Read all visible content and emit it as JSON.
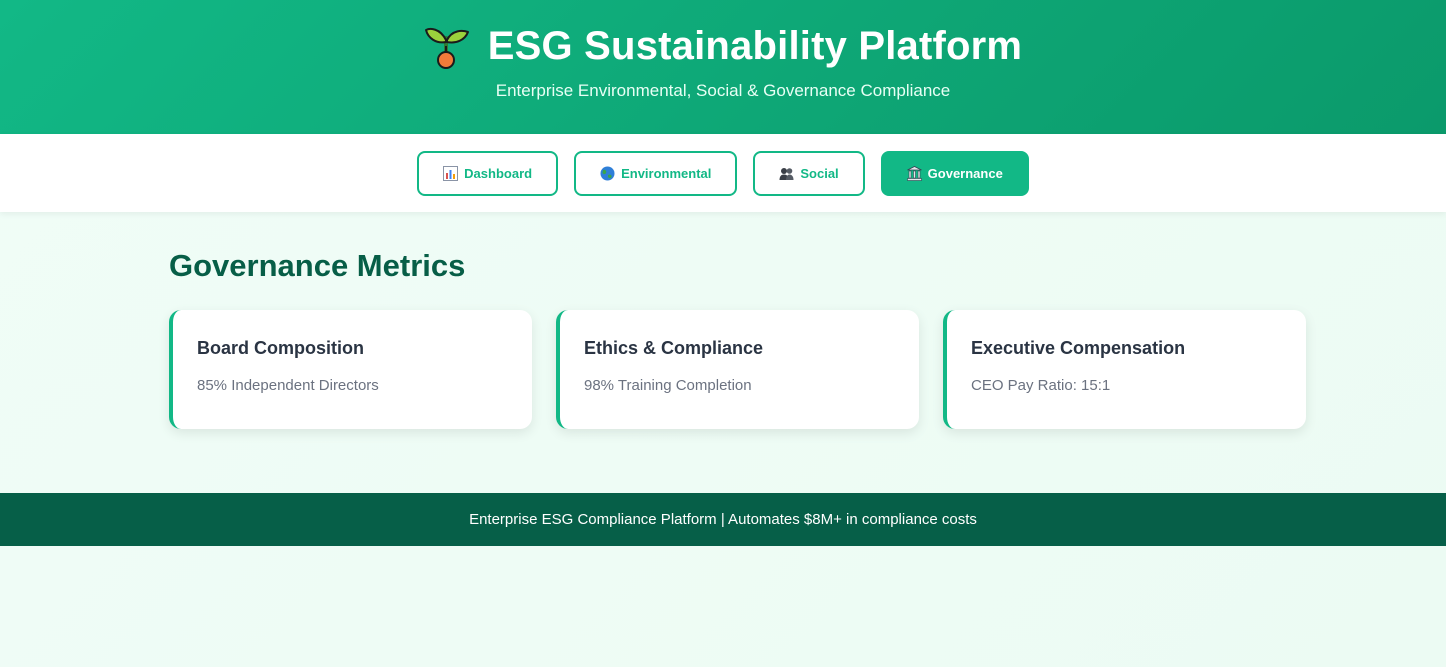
{
  "header": {
    "title": "ESG Sustainability Platform",
    "subtitle": "Enterprise Environmental, Social & Governance Compliance",
    "logo_icon": "seedling-icon"
  },
  "nav": {
    "tabs": [
      {
        "label": "Dashboard",
        "icon": "bar-chart-icon",
        "active": false
      },
      {
        "label": "Environmental",
        "icon": "globe-icon",
        "active": false
      },
      {
        "label": "Social",
        "icon": "people-icon",
        "active": false
      },
      {
        "label": "Governance",
        "icon": "classical-building-icon",
        "active": true
      }
    ]
  },
  "main": {
    "section_title": "Governance Metrics",
    "cards": [
      {
        "title": "Board Composition",
        "text": "85% Independent Directors"
      },
      {
        "title": "Ethics & Compliance",
        "text": "98% Training Completion"
      },
      {
        "title": "Executive Compensation",
        "text": "CEO Pay Ratio: 15:1"
      }
    ]
  },
  "footer": {
    "text": "Enterprise ESG Compliance Platform | Automates $8M+ in compliance costs"
  },
  "colors": {
    "brand": "#12b886",
    "brand_dark": "#065f48",
    "heading": "#075e47"
  }
}
